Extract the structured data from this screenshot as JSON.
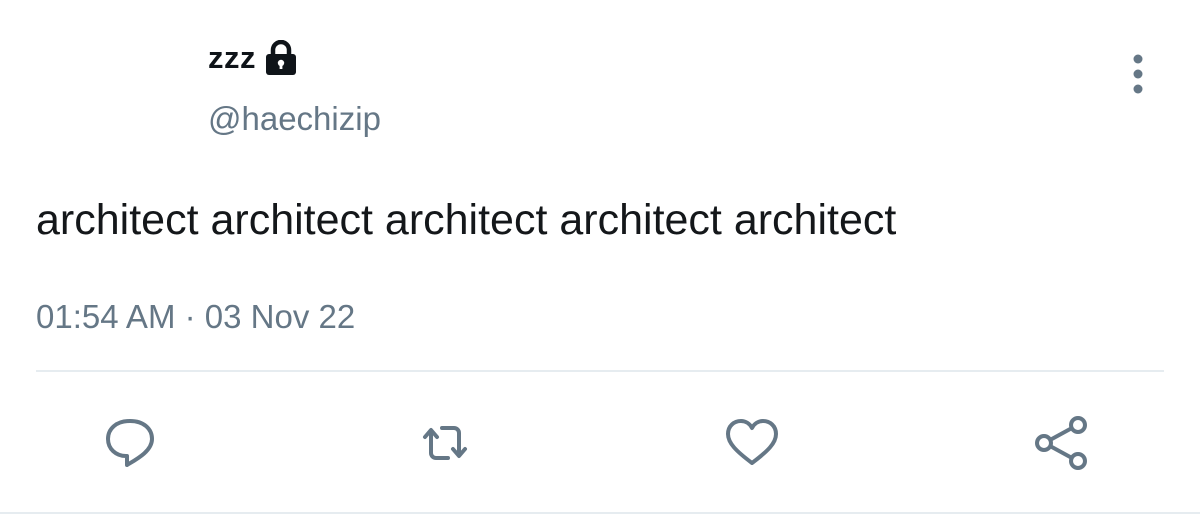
{
  "tweet": {
    "author": {
      "display_name": "zzz",
      "handle": "@haechizip",
      "protected_icon": "lock-icon"
    },
    "text": "architect architect architect architect architect",
    "timestamp": "01:54 AM · 03 Nov 22"
  },
  "actions": [
    {
      "name": "reply",
      "icon": "reply-icon"
    },
    {
      "name": "retweet",
      "icon": "retweet-icon"
    },
    {
      "name": "like",
      "icon": "heart-icon"
    },
    {
      "name": "share",
      "icon": "share-icon"
    }
  ],
  "menu": {
    "icon": "more-vertical-icon"
  },
  "colors": {
    "text_primary": "#14171a",
    "text_secondary": "#657786",
    "icon": "#657786",
    "divider": "#e6ecf0"
  }
}
